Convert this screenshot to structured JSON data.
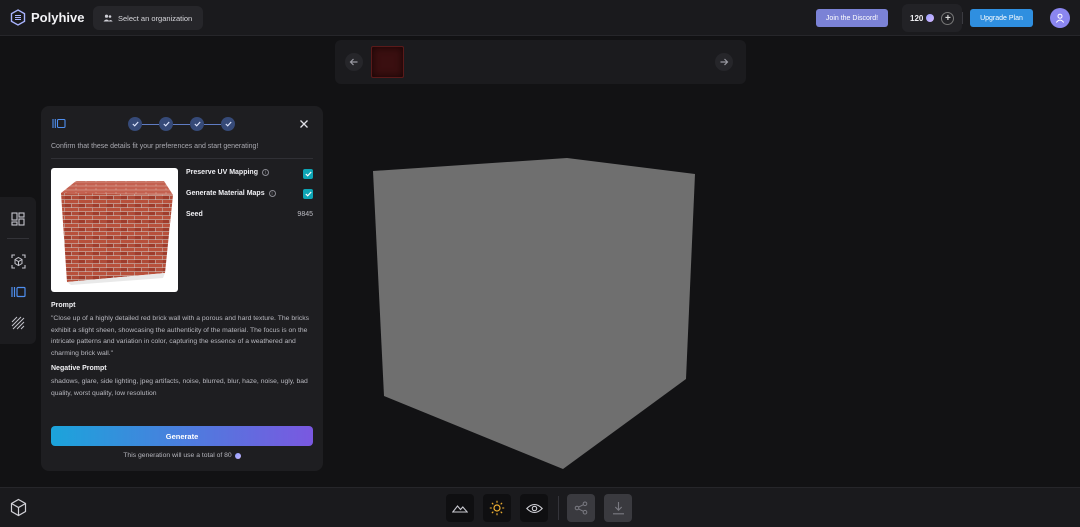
{
  "app": {
    "name": "Polyhive"
  },
  "header": {
    "org_selector_label": "Select an organization",
    "discord_label": "Join the Discord!",
    "credits": "120",
    "upgrade_label": "Upgrade Plan"
  },
  "panel": {
    "steps_completed": 4,
    "confirm_text": "Confirm that these details fit your preferences and start generating!",
    "preserve_uv_label": "Preserve UV Mapping",
    "preserve_uv_checked": true,
    "generate_maps_label": "Generate Material Maps",
    "generate_maps_checked": true,
    "seed_label": "Seed",
    "seed_value": "9845",
    "prompt_title": "Prompt",
    "prompt_text": "\"Close up of a highly detailed red brick wall with a porous and hard texture. The bricks exhibit a slight sheen, showcasing the authenticity of the material. The focus is on the intricate patterns and variation in color, capturing the essence of a weathered and charming brick wall.\"",
    "negative_title": "Negative Prompt",
    "negative_text": "shadows, glare, side lighting, jpeg artifacts, noise, blurred, blur, haze, noise, ugly, bad quality, worst quality, low resolution",
    "generate_label": "Generate",
    "cost_text": "This generation will use a total of 80"
  },
  "colors": {
    "accent_discord": "#7b82d6",
    "accent_upgrade": "#2f8fe0",
    "checkbox": "#0ea5b5",
    "cube": "#6f6f6f"
  },
  "icons": {
    "leftbar": [
      "layout-icon",
      "cube-scan-icon",
      "texture-panel-icon",
      "hatch-pattern-icon"
    ],
    "bottombar": [
      "mountain-icon",
      "sun-icon",
      "eye-icon",
      "share-icon",
      "download-icon"
    ]
  }
}
